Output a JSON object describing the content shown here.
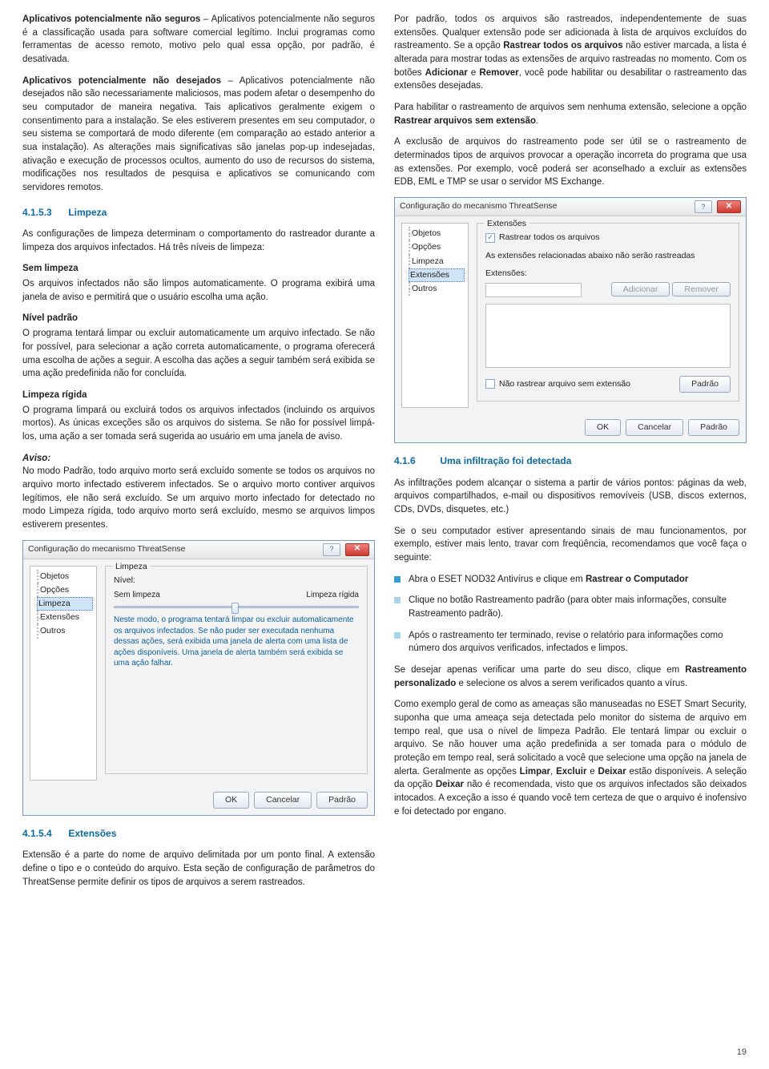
{
  "left": {
    "p1_lead": "Aplicativos potencialmente não seguros",
    "p1_rest": " – Aplicativos potencialmente não seguros é a classificação usada para software comercial legítimo. Inclui programas como ferramentas de acesso remoto, motivo pelo qual essa opção, por padrão, é desativada.",
    "p2_lead": "Aplicativos potencialmente não desejados",
    "p2_rest": " – Aplicativos potencialmente não desejados não são necessariamente maliciosos, mas podem afetar o desempenho do seu computador de maneira negativa. Tais aplicativos geralmente exigem o consentimento para a instalação. Se eles estiverem presentes em seu computador, o seu sistema se comportará de modo diferente (em comparação ao estado anterior a sua instalação). As alterações mais significativas são janelas pop-up indesejadas, ativação e execução de processos ocultos, aumento do uso de recursos do sistema, modificações nos resultados de pesquisa e aplicativos se comunicando com servidores remotos.",
    "h_4153_num": "4.1.5.3",
    "h_4153_title": "Limpeza",
    "p3": "As configurações de limpeza determinam o comportamento do rastreador durante a limpeza dos arquivos infectados. Há três níveis de limpeza:",
    "sem_limpeza_h": "Sem limpeza",
    "sem_limpeza_p": "Os arquivos infectados não são limpos automaticamente. O programa exibirá uma janela de aviso e permitirá que o usuário escolha uma ação.",
    "nivel_padrao_h": "Nível padrão",
    "nivel_padrao_p": "O programa tentará limpar ou excluir automaticamente um arquivo infectado. Se não for possível, para selecionar a ação correta automaticamente, o programa oferecerá uma escolha de ações a seguir. A escolha das ações a seguir também será exibida se uma ação predefinida não for concluída.",
    "limpeza_rigida_h": "Limpeza rígida",
    "limpeza_rigida_p": "O programa limpará ou excluirá todos os arquivos infectados (incluindo os arquivos mortos). As únicas exceções são os arquivos do sistema. Se não for possível limpá-los, uma ação a ser tomada será sugerida ao usuário em uma janela de aviso.",
    "aviso_h": "Aviso:",
    "aviso_p": "No modo Padrão, todo arquivo morto será excluído somente se todos os arquivos no arquivo morto infectado estiverem infectados. Se o arquivo morto contiver arquivos legítimos, ele não será excluído. Se um arquivo morto infectado for detectado no modo Limpeza rígida, todo arquivo morto será excluído, mesmo se arquivos limpos estiverem presentes.",
    "h_4154_num": "4.1.5.4",
    "h_4154_title": "Extensões",
    "p_ext": "Extensão é a parte do nome de arquivo delimitada por um ponto final. A extensão define o tipo e o conteúdo do arquivo. Esta seção de configuração de parâmetros do ThreatSense permite definir os tipos de arquivos a serem rastreados."
  },
  "right": {
    "p1a": "Por padrão, todos os arquivos são rastreados, independentemente de suas extensões. Qualquer extensão pode ser adicionada à lista de arquivos excluídos do rastreamento. Se a opção ",
    "p1b_bold": "Rastrear todos os arquivos",
    "p1c": " não estiver marcada, a lista é alterada para mostrar todas as extensões de arquivo rastreadas no momento. Com os botões ",
    "p1d_bold": "Adicionar",
    "p1e": " e ",
    "p1f_bold": "Remover",
    "p1g": ", você pode habilitar ou desabilitar o rastreamento das extensões desejadas.",
    "p2a": "Para habilitar o rastreamento de arquivos sem nenhuma extensão, selecione a opção ",
    "p2b_bold": "Rastrear arquivos sem extensão",
    "p2c": ".",
    "p3": "A exclusão de arquivos do rastreamento pode ser útil se o rastreamento de determinados tipos de arquivos provocar a operação incorreta do programa que usa as extensões. Por exemplo, você poderá ser aconselhado a excluir as extensões EDB, EML e TMP se usar o servidor MS Exchange.",
    "h_416_num": "4.1.6",
    "h_416_title": "Uma infiltração foi detectada",
    "p4": "As infiltrações podem alcançar o sistema a partir de vários pontos: páginas da web, arquivos compartilhados, e-mail ou dispositivos removíveis (USB, discos externos, CDs, DVDs, disquetes, etc.)",
    "p5": "Se o seu computador estiver apresentando sinais de mau funcionamentos, por exemplo, estiver mais lento, travar com freqüência, recomendamos que você faça o seguinte:",
    "b1a": "Abra o ESET NOD32 Antivírus e clique em ",
    "b1b_bold": "Rastrear o Computador",
    "b2": "Clique no botão Rastreamento padrão (para obter mais informações, consulte Rastreamento padrão).",
    "b3": "Após o rastreamento ter terminado, revise o relatório para informações como número dos arquivos verificados, infectados e limpos.",
    "p6a": "Se desejar apenas verificar uma parte do seu disco, clique em ",
    "p6b_bold": "Rastreamento personalizado",
    "p6c": " e selecione os alvos a serem verificados quanto a vírus.",
    "p7a": "Como exemplo geral de como as ameaças são manuseadas no ESET Smart Security, suponha que uma ameaça seja detectada pelo monitor do sistema de arquivo em tempo real, que usa o nível de limpeza Padrão. Ele tentará limpar ou excluir o arquivo. Se não houver uma ação predefinida a ser tomada para o módulo de proteção em tempo real, será solicitado a você que selecione uma opção na janela de alerta. Geralmente as opções ",
    "p7b_bold": "Limpar",
    "p7c": ", ",
    "p7d_bold": "Excluir",
    "p7e": " e ",
    "p7f_bold": "Deixar",
    "p7g": " estão disponíveis. A seleção da opção ",
    "p7h_bold": "Deixar",
    "p7i": " não é recomendada, visto que os arquivos infectados são deixados intocados. A exceção a isso é quando você tem certeza de que o arquivo é inofensivo e foi detectado por engano."
  },
  "dialog1": {
    "title": "Configuração do mecanismo ThreatSense",
    "tree": [
      "Objetos",
      "Opções",
      "Limpeza",
      "Extensões",
      "Outros"
    ],
    "group": "Limpeza",
    "nivel_label": "Nível:",
    "slider_left": "Sem limpeza",
    "slider_right": "Limpeza rígida",
    "desc": "Neste modo, o programa tentará limpar ou excluir automaticamente os arquivos infectados. Se não puder ser executada nenhuma dessas ações, será exibida uma janela de alerta com uma lista de ações disponíveis. Uma janela de alerta também será exibida se uma ação falhar.",
    "btn_ok": "OK",
    "btn_cancel": "Cancelar",
    "btn_default": "Padrão"
  },
  "dialog2": {
    "title": "Configuração do mecanismo ThreatSense",
    "tree": [
      "Objetos",
      "Opções",
      "Limpeza",
      "Extensões",
      "Outros"
    ],
    "group": "Extensões",
    "chk_all": "Rastrear todos os arquivos",
    "note": "As extensões relacionadas abaixo não serão rastreadas",
    "ext_label": "Extensões:",
    "btn_add": "Adicionar",
    "btn_remove": "Remover",
    "chk_noext": "Não rastrear arquivo sem extensão",
    "btn_default2": "Padrão",
    "btn_ok": "OK",
    "btn_cancel": "Cancelar",
    "btn_default": "Padrão"
  },
  "page_number": "19"
}
